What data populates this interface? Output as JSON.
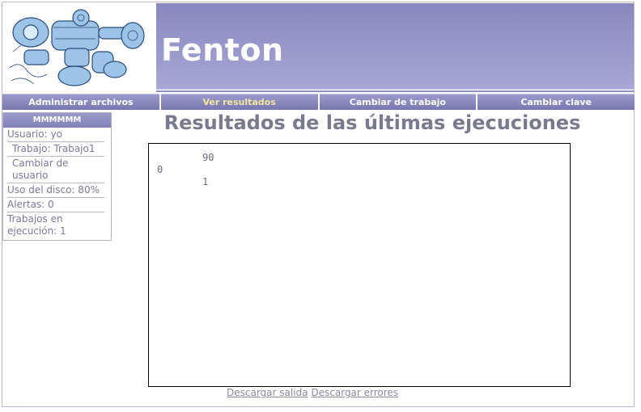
{
  "header": {
    "title": "Fenton",
    "logo": "robot-mascot-logo"
  },
  "nav": {
    "items": [
      {
        "label": "Administrar archivos",
        "active": false
      },
      {
        "label": "Ver resultados",
        "active": true
      },
      {
        "label": "Cambiar de trabajo",
        "active": false
      },
      {
        "label": "Cambiar clave",
        "active": false
      }
    ]
  },
  "sidebar": {
    "header": "MMMMMM",
    "usuario": "Usuario: yo",
    "trabajo": "Trabajo: Trabajo1",
    "cambiar_usuario": "Cambiar de usuario",
    "disco": "Uso del disco: 80%",
    "alertas": "Alertas: 0",
    "en_ejecucion": "Trabajos en ejecución: 1"
  },
  "main": {
    "title": "Resultados de las últimas ejecuciones",
    "output_lines": [
      "90",
      "0",
      "1"
    ],
    "download_output": "Descargar salida",
    "download_errors": "Descargar errores"
  },
  "colors": {
    "banner": "#8888c0",
    "nav": "#8484bc",
    "active_nav_text": "#f2e6a0"
  }
}
